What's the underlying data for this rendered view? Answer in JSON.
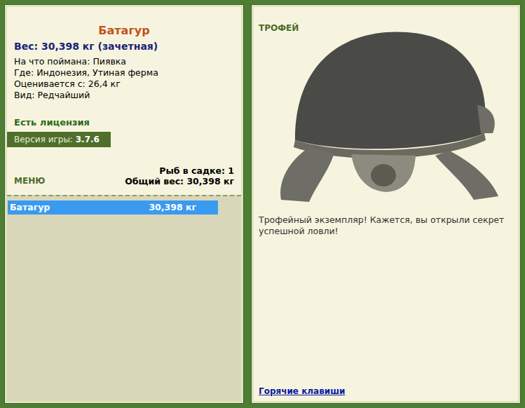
{
  "fish": {
    "name": "Батагур",
    "weight": "Вес: 30,398 кг (зачетная)"
  },
  "info": [
    {
      "label": "На что поймана:",
      "value": "Пиявка"
    },
    {
      "label": "Где:",
      "value": "Индонезия, Утиная ферма"
    },
    {
      "label": "Оценивается с:",
      "value": "26,4 кг"
    },
    {
      "label": "Вид:",
      "value": "Редчайший"
    }
  ],
  "license": "Есть лицензия",
  "version": {
    "label": "Версия игры:",
    "value": "3.7.6"
  },
  "menu": "МЕНЮ",
  "keepnet": {
    "count": "Рыб в садке: 1",
    "total": "Общий вес: 30,398 кг"
  },
  "catches": [
    {
      "name": "Батагур",
      "weight": "30,398 кг",
      "selected": true
    }
  ],
  "trophy": {
    "label": "ТРОФЕЙ",
    "message": "Трофейный экземпляр! Кажется, вы открыли секрет успешной ловли!"
  },
  "hotkeys": "Горячие клавиши"
}
